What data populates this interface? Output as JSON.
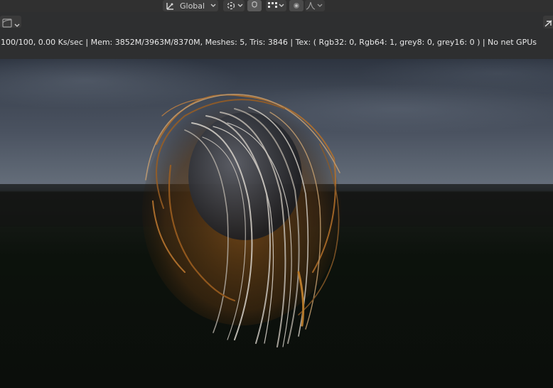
{
  "header": {
    "transform_orientation": "Global"
  },
  "status_bar": {
    "text": "100/100, 0.00 Ks/sec | Mem: 3852M/3963M/8370M, Meshes: 5, Tris: 3846 | Tex: ( Rgb32: 0, Rgb64: 1, grey8: 0, grey16: 0 ) | No net GPUs"
  },
  "colors": {
    "header_bg": "#303030",
    "widget_bg": "#3d3d3d",
    "text": "#e8e8e8",
    "hair_orange": "#b5712a",
    "hair_light": "#c9c4bd"
  },
  "icons": [
    "transform-orientation-icon",
    "chevron-down-icon",
    "pivot-point-icon",
    "snap-icon",
    "proportional-edit-icon",
    "falloff-icon",
    "editor-type-icon",
    "gizmo-toggle-icon"
  ]
}
